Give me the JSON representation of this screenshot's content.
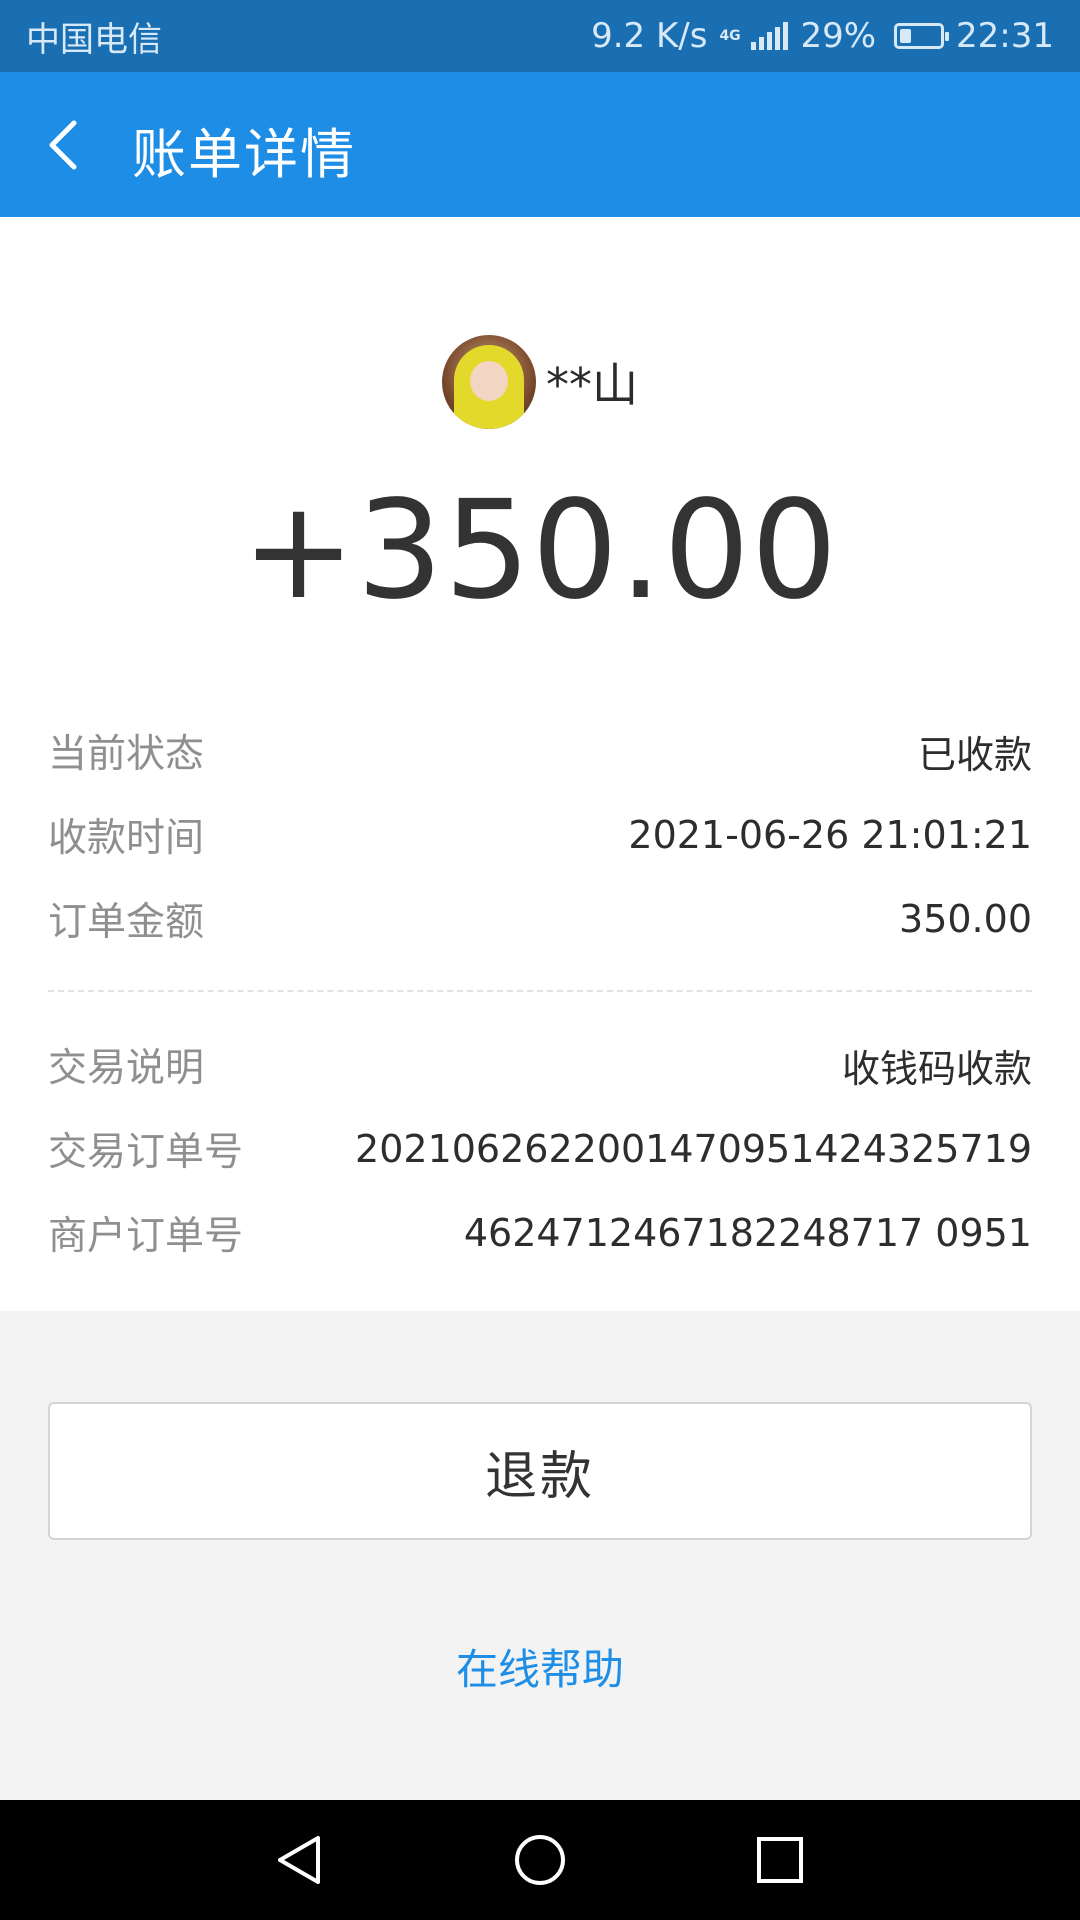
{
  "status_bar": {
    "carrier": "中国电信",
    "net_speed": "9.2 K/s",
    "network_type": "4G",
    "battery_level": 0.29,
    "battery_text": "29%",
    "time": "22:31"
  },
  "header": {
    "title": "账单详情",
    "color": "#1e8de6"
  },
  "payment": {
    "payer_name": "**山",
    "amount": "+350.00"
  },
  "details_primary": [
    {
      "label": "当前状态",
      "value": "已收款"
    },
    {
      "label": "收款时间",
      "value": "2021-06-26 21:01:21"
    },
    {
      "label": "订单金额",
      "value": "350.00"
    }
  ],
  "details_secondary": [
    {
      "label": "交易说明",
      "value": "收钱码收款"
    },
    {
      "label": "交易订单号",
      "value": "2021062622001470951424325719"
    },
    {
      "label": "商户订单号",
      "value": "4624712467182248717 0951"
    }
  ],
  "actions": {
    "refund_label": "退款",
    "help_label": "在线帮助",
    "link_color": "#1f8ee6"
  },
  "icons": {
    "back": "chevron-left-icon",
    "nav_back": "triangle-back-icon",
    "nav_home": "circle-home-icon",
    "nav_recents": "square-recents-icon"
  }
}
